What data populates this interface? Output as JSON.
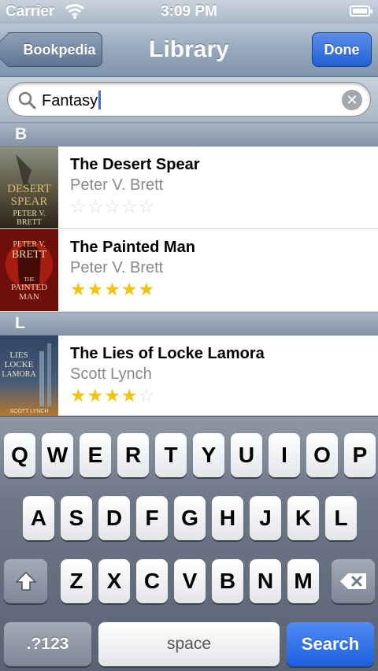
{
  "status_bar": {
    "carrier": "Carrier",
    "time": "3:09 PM"
  },
  "nav": {
    "back_label": "Bookpedia",
    "title": "Library",
    "done_label": "Done"
  },
  "search": {
    "value": "Fantasy"
  },
  "sections": [
    {
      "letter": "B",
      "books": [
        {
          "title": "The Desert Spear",
          "author": "Peter V. Brett",
          "rating": 0,
          "cover_text": [
            "DESERT",
            "SPEAR",
            "PETER V.",
            "BRETT"
          ]
        },
        {
          "title": "The Painted Man",
          "author": "Peter V. Brett",
          "rating": 5,
          "cover_text": [
            "PETER V.",
            "BRETT",
            "THE",
            "PAINTED",
            "MAN"
          ]
        }
      ]
    },
    {
      "letter": "L",
      "books": [
        {
          "title": "The Lies of Locke Lamora",
          "author": "Scott Lynch",
          "rating": 4,
          "cover_text": [
            "LIES",
            "LOCKE",
            "LAMORA",
            "SCOTT LYNCH"
          ]
        }
      ]
    }
  ],
  "rating_max": 5,
  "keyboard": {
    "row1": [
      "Q",
      "W",
      "E",
      "R",
      "T",
      "Y",
      "U",
      "I",
      "O",
      "P"
    ],
    "row2": [
      "A",
      "S",
      "D",
      "F",
      "G",
      "H",
      "J",
      "K",
      "L"
    ],
    "row3": [
      "Z",
      "X",
      "C",
      "V",
      "B",
      "N",
      "M"
    ],
    "numbers_label": ".?123",
    "space_label": "space",
    "search_label": "Search"
  },
  "colors": {
    "star": "#f2c30a",
    "accent": "#2160d6"
  }
}
